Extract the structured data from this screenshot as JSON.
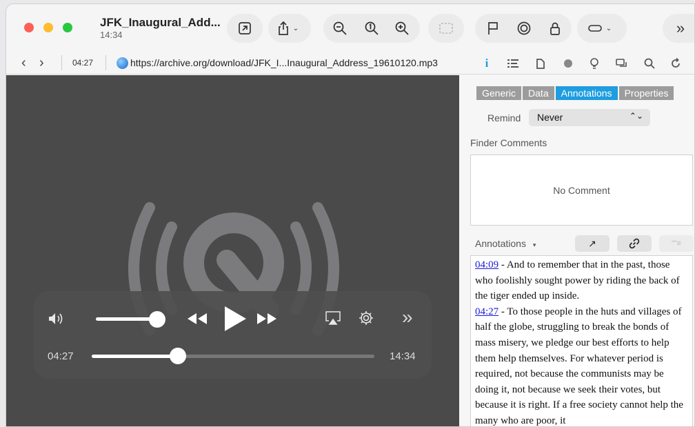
{
  "window": {
    "title": "JFK_Inaugural_Add...",
    "duration": "14:34"
  },
  "toolbar": {
    "icons": [
      "external-link-icon",
      "share-icon",
      "zoom-out-icon",
      "actual-size-icon",
      "zoom-in-icon",
      "crop-icon",
      "flag-icon",
      "target-icon",
      "lock-icon",
      "toggle-icon",
      "more-icon"
    ]
  },
  "addressbar": {
    "back": "‹",
    "forward": "›",
    "time": "04:27",
    "url": "https://archive.org/download/JFK_I...Inaugural_Address_19610120.mp3",
    "inspector_icons": [
      "info-icon",
      "list-icon",
      "document-icon",
      "circle-icon",
      "lightbulb-icon",
      "chat-icon",
      "search-icon",
      "refresh-icon"
    ]
  },
  "player": {
    "current_time": "04:27",
    "total_time": "14:34",
    "progress": 0.305,
    "volume": 0.9
  },
  "inspector": {
    "tabs": [
      "Generic",
      "Data",
      "Annotations",
      "Properties"
    ],
    "selected_tab": "Annotations",
    "remind_label": "Remind",
    "remind_value": "Never",
    "finder_comments_label": "Finder Comments",
    "finder_comments_value": "No Comment",
    "annotations_label": "Annotations",
    "annotations": [
      {
        "timestamp": "04:09",
        "text": " - And to remember that in the past, those who foolishly sought power by riding the back of the tiger ended up inside."
      },
      {
        "timestamp": "04:27",
        "text": " - To those people in the huts and villages of half the globe, struggling to break the bonds of mass misery, we pledge our best efforts to help them help themselves. For whatever period is required, not because the communists may be doing it, not because we seek their votes, but because it is right. If a free society cannot help the many who are poor, it"
      }
    ]
  },
  "colors": {
    "accent": "#1e9de0",
    "player_bg": "#4a4a4a",
    "link": "#1a1ad8"
  }
}
